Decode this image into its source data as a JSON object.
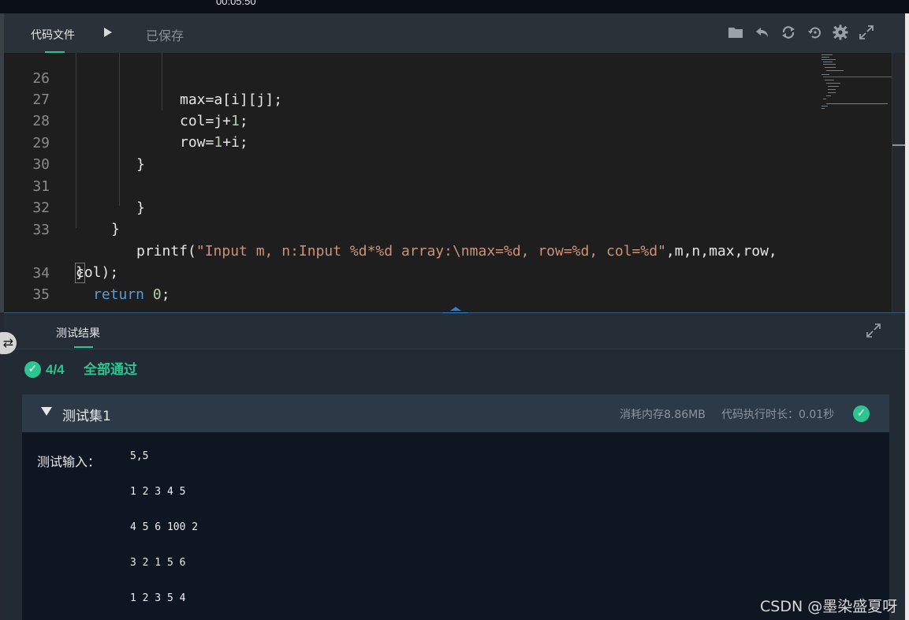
{
  "timer": "00:05:50",
  "toolbar": {
    "tab_code": "代码文件",
    "saved": "已保存"
  },
  "code_lines": [
    {
      "num": "26",
      "text": "max=a[i][j];"
    },
    {
      "num": "27",
      "pre": "col=j+",
      "num1": "1",
      "post": ";"
    },
    {
      "num": "28",
      "pre": "row=",
      "num1": "1",
      "post": "+i;"
    },
    {
      "num": "29",
      "text": "}"
    },
    {
      "num": "30",
      "text": ""
    },
    {
      "num": "31",
      "text": "}"
    },
    {
      "num": "32",
      "text": "}"
    },
    {
      "num": "33",
      "fn": "printf(",
      "str": "\"Input m, n:Input %d*%d array:\\nmax=%d, row=%d, col=%d\"",
      "rest": ",m,n,max,row,"
    },
    {
      "num": "",
      "text": "col);"
    },
    {
      "num": "34",
      "kw": "return",
      "num1": "0",
      "post": ";"
    },
    {
      "num": "35",
      "text": "}"
    }
  ],
  "results": {
    "tab": "测试结果",
    "pass_count": "4/4",
    "pass_text": "全部通过",
    "case": {
      "title": "测试集1",
      "memory": "消耗内存8.86MB",
      "time": "代码执行时长：0.01秒",
      "input_label": "测试输入：",
      "input_lines": [
        "5,5",
        "1 2 3 4 5",
        "4 5 6 100 2",
        "3 2 1 5 6",
        "1 2 3 5 4"
      ]
    }
  },
  "watermark": "CSDN @墨染盛夏呀",
  "icons": [
    "play-icon",
    "folder-icon",
    "undo-icon",
    "refresh-icon",
    "history-icon",
    "settings-icon",
    "fullscreen-icon",
    "expand-icon",
    "check-circle-icon",
    "caret-down-icon",
    "swap-icon"
  ],
  "colors": {
    "accent_green": "#2ec492",
    "editor_bg": "#1e1e1e",
    "string": "#ce9178",
    "keyword": "#569cd6",
    "number": "#b5cea8"
  }
}
